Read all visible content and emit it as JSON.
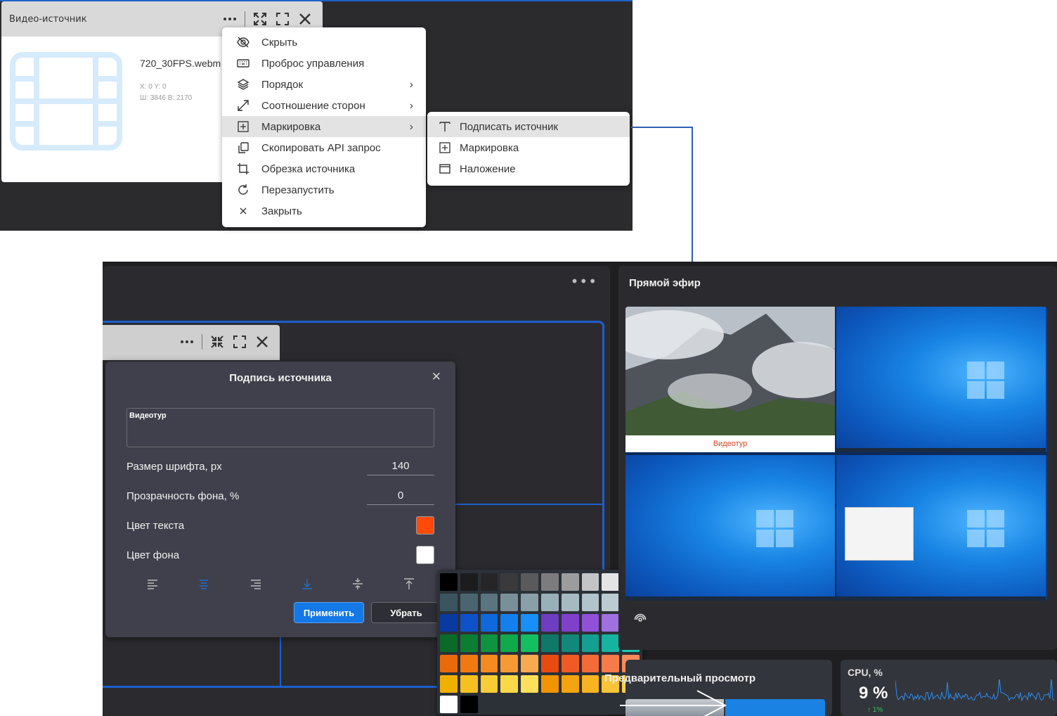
{
  "source_card": {
    "title": "Видео-источник",
    "filename": "720_30FPS.webm",
    "coords": "X: 0 Y: 0",
    "size": "Ш: 3846 В: 2170"
  },
  "context_menu": {
    "items": [
      {
        "label": "Скрыть",
        "icon": "eye-off-icon"
      },
      {
        "label": "Проброс управления",
        "icon": "keyboard-icon"
      },
      {
        "label": "Порядок",
        "icon": "layers-icon",
        "submenu": true
      },
      {
        "label": "Соотношение сторон",
        "icon": "expand-diagonal-icon",
        "submenu": true
      },
      {
        "label": "Маркировка",
        "icon": "marker-grid-icon",
        "submenu": true,
        "highlighted": true
      },
      {
        "label": "Скопировать API запрос",
        "icon": "copy-icon"
      },
      {
        "label": "Обрезка источника",
        "icon": "crop-icon"
      },
      {
        "label": "Перезапустить",
        "icon": "restart-icon"
      },
      {
        "label": "Закрыть",
        "icon": "close-icon"
      }
    ]
  },
  "submenu": {
    "items": [
      {
        "label": "Подписать источник",
        "icon": "text-t-icon",
        "highlighted": true
      },
      {
        "label": "Маркировка",
        "icon": "marker-grid-icon"
      },
      {
        "label": "Наложение",
        "icon": "window-icon"
      }
    ]
  },
  "live_panel": {
    "title": "Прямой эфир",
    "caption_text": "Видеотур"
  },
  "dialog": {
    "title": "Подпись источника",
    "caption_value": "Видеотур",
    "font_size_label": "Размер шрифта, px",
    "font_size_value": "140",
    "bg_opacity_label": "Прозрачность фона, %",
    "bg_opacity_value": "0",
    "text_color_label": "Цвет текста",
    "text_color": "#ff4a0a",
    "bg_color_label": "Цвет фона",
    "bg_color": "#ffffff",
    "apply_label": "Применить",
    "remove_label": "Убрать"
  },
  "palette": {
    "rows": [
      [
        "#000000",
        "#1c1c1e",
        "#262628",
        "#3a3a3c",
        "#5a5a5c",
        "#7c7c7e",
        "#9c9c9e",
        "#c4c4c6",
        "#e4e4e6",
        "#ffffff"
      ],
      [
        "#3a5560",
        "#4a6570",
        "#5a7580",
        "#7a9098",
        "#8aa0a8",
        "#9ab0b8",
        "#a6bac2",
        "#b2c4cb",
        "#bccbd2",
        "#c6d4da"
      ],
      [
        "#0a3aa0",
        "#0d52c8",
        "#1068dd",
        "#1480ee",
        "#1890fa",
        "#6e3dc0",
        "#8040cc",
        "#9050d8",
        "#a070e0",
        "#b088e8"
      ],
      [
        "#0a6a2a",
        "#0c7e34",
        "#0e943e",
        "#10aa4a",
        "#12c060",
        "#107868",
        "#128878",
        "#14a090",
        "#16b4a0",
        "#18c8b0"
      ],
      [
        "#e86a0a",
        "#f07a10",
        "#f58a20",
        "#f89a34",
        "#f9aa50",
        "#e84a10",
        "#f05a24",
        "#f46a38",
        "#f67a4a",
        "#f88a5c"
      ],
      [
        "#f0b000",
        "#f5c020",
        "#f8cc34",
        "#fad848",
        "#fce05a",
        "#f09400",
        "#f4a410",
        "#f8b420",
        "#fac438",
        "#fcd04c"
      ],
      [
        "#ffffff",
        "#000000"
      ]
    ]
  },
  "preview_panel": {
    "title": "Предварительный просмотр"
  },
  "cpu_panel": {
    "title": "CPU, %",
    "value": "9 %",
    "delta": "↑ 1%"
  }
}
